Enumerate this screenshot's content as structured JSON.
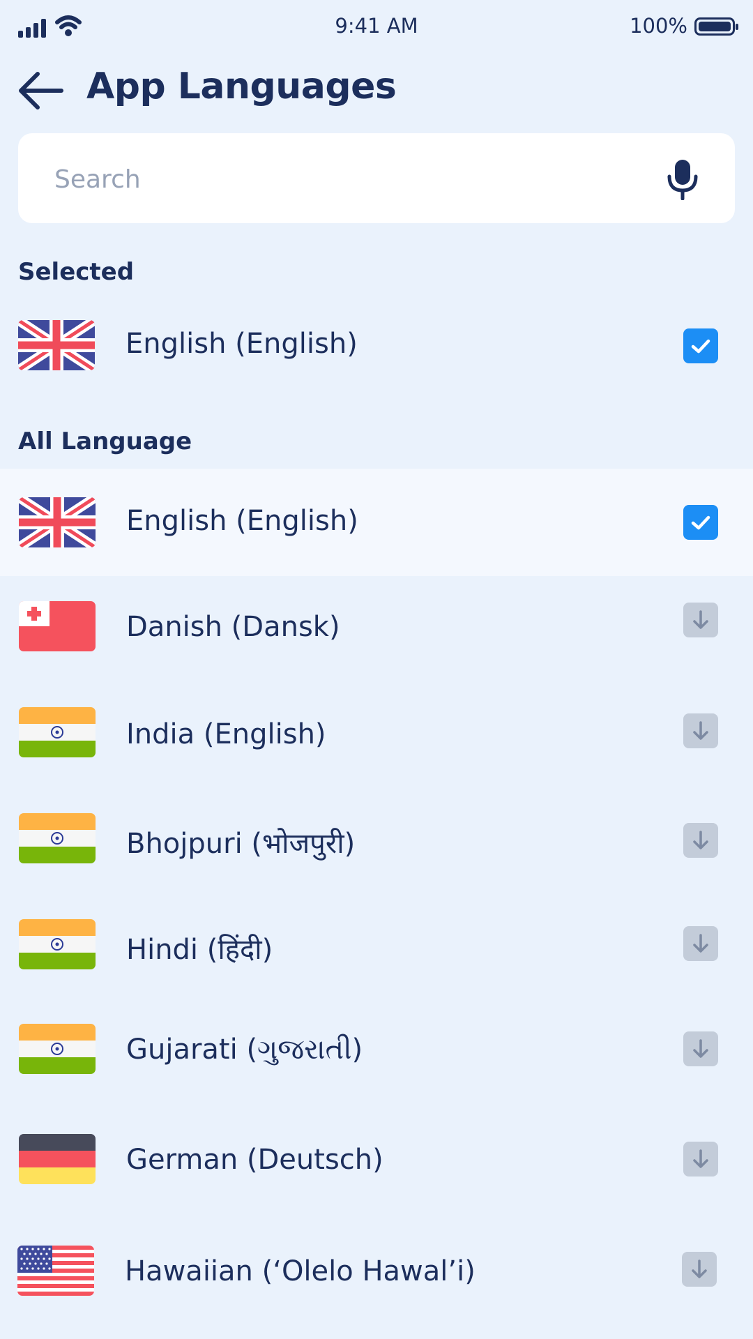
{
  "status_bar": {
    "time": "9:41 AM",
    "battery": "100%"
  },
  "header": {
    "title": "App Languages"
  },
  "search": {
    "placeholder": "Search"
  },
  "sections": {
    "selected": "Selected",
    "all": "All Language"
  },
  "selected_items": [
    {
      "label": "English (English)",
      "flag": "uk-flag",
      "checked": true
    }
  ],
  "languages": [
    {
      "label": "English (English)",
      "flag": "uk-flag",
      "checked": true
    },
    {
      "label": "Danish (Dansk)",
      "flag": "tonga-flag",
      "checked": false
    },
    {
      "label": "India (English)",
      "flag": "india-flag",
      "checked": false
    },
    {
      "label": "Bhojpuri (भोजपुरी)",
      "flag": "india-flag",
      "checked": false
    },
    {
      "label": "Hindi (हिंदी)",
      "flag": "india-flag",
      "checked": false
    },
    {
      "label": "Gujarati (ગુજરાતી)",
      "flag": "india-flag",
      "checked": false
    },
    {
      "label": "German (Deutsch)",
      "flag": "germany-flag",
      "checked": false
    },
    {
      "label": "Hawaiian (‘Olelo Hawal’i)",
      "flag": "usa-flag",
      "checked": false
    }
  ],
  "colors": {
    "background": "#eaf2fc",
    "text": "#1c2e5c",
    "accent": "#1c8ef5",
    "download_button": "#c3ccd9",
    "highlight_row": "#f4f8fe"
  }
}
